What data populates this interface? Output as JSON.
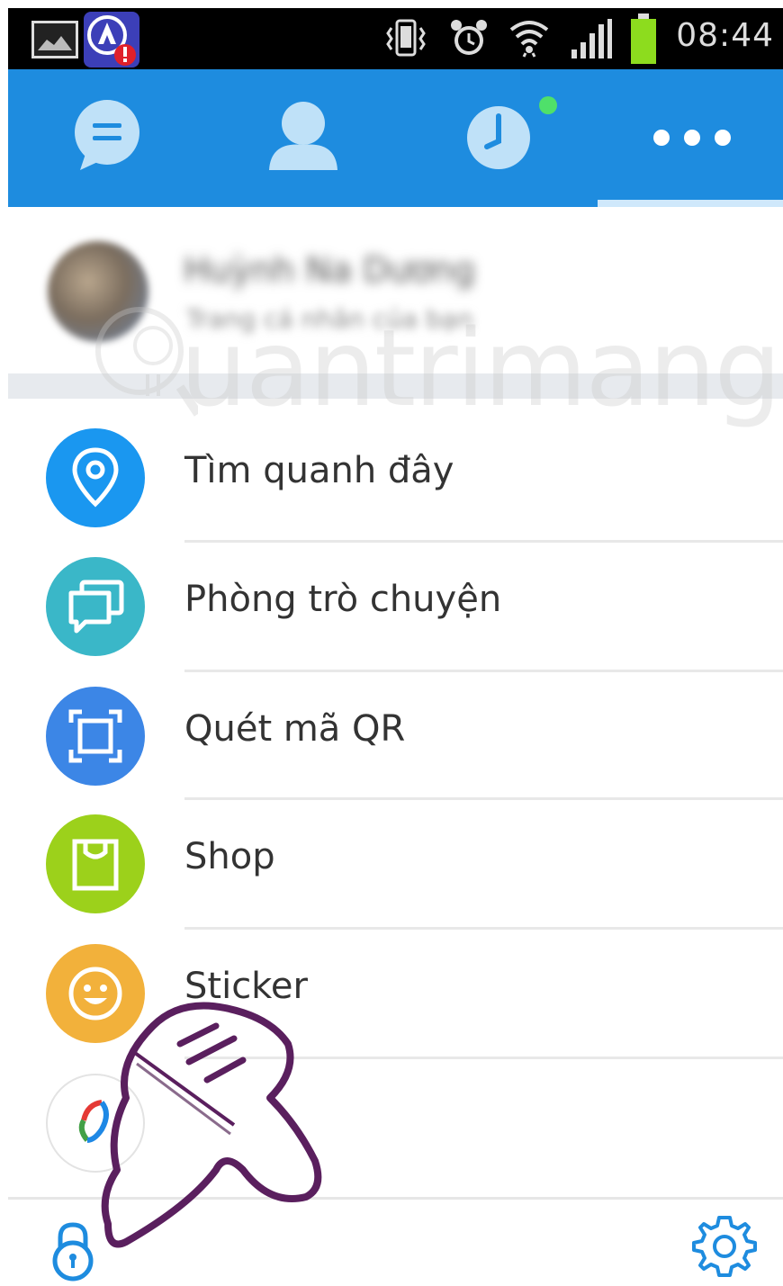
{
  "status_bar": {
    "time": "08:44",
    "icons": [
      "gallery-icon",
      "app-alert-icon",
      "vibrate-icon",
      "alarm-icon",
      "wifi-icon",
      "signal-icon",
      "battery-icon"
    ],
    "battery_color": "#8ddc1e",
    "alert_color": "#e0202a"
  },
  "tabs": {
    "items": [
      "chat-icon",
      "contacts-icon",
      "timeline-icon",
      "more-icon"
    ],
    "active_index": 3,
    "has_notification_dot": true,
    "accent_color": "#1e8cdf",
    "dot_color": "#4fe06a"
  },
  "profile": {
    "name": "Huỳnh Na Dương",
    "subtitle": "Trang cá nhân của bạn"
  },
  "menu": {
    "items": [
      {
        "label": "Tìm quanh đây",
        "icon": "location-pin-icon",
        "color": "#1a97f0"
      },
      {
        "label": "Phòng trò chuyện",
        "icon": "chat-rooms-icon",
        "color": "#3ab7c8"
      },
      {
        "label": "Quét mã QR",
        "icon": "qr-scan-icon",
        "color": "#3c86e6"
      },
      {
        "label": "Shop",
        "icon": "shopping-bag-icon",
        "color": "#9cd11b"
      },
      {
        "label": "Sticker",
        "icon": "smiley-icon",
        "color": "#f2b13b"
      },
      {
        "label": "",
        "icon": "app-logo-icon",
        "color": "#ffffff"
      }
    ]
  },
  "bottom_bar": {
    "left_icon": "lock-icon",
    "right_icon": "settings-gear-icon"
  },
  "watermark": {
    "text": "uantrimang"
  }
}
